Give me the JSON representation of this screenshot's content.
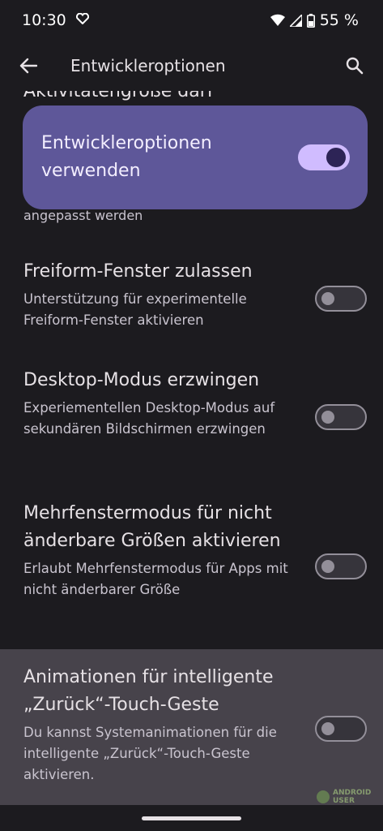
{
  "status_bar": {
    "time": "10:30",
    "battery": "55 %",
    "icons": [
      "heart-icon",
      "wifi-icon",
      "signal-icon",
      "battery-icon"
    ]
  },
  "app_bar": {
    "title": "Entwickleroptionen",
    "back_icon": "arrow-back-icon",
    "search_icon": "search-icon"
  },
  "master_switch": {
    "label": "Entwickleroptionen verwenden",
    "state": "on"
  },
  "partial_item": {
    "title_fragment": "Aktivitätengröße darf",
    "summary_fragment": "angepasst werden"
  },
  "settings": [
    {
      "title": "Freiform-Fenster zulassen",
      "summary": "Unterstützung für experimentelle Freiform-Fenster aktivieren",
      "state": "off"
    },
    {
      "title": "Desktop-Modus erzwingen",
      "summary": "Experiementellen Desktop-Modus auf sekundären Bildschirmen erzwingen",
      "state": "off"
    },
    {
      "title": "Mehrfenstermodus für nicht änderbare Größen aktivieren",
      "summary": "Erlaubt Mehrfenstermodus für Apps mit nicht änderbarer Größe",
      "state": "off"
    },
    {
      "title": "Animationen für intelligente „Zurück“-Touch-Geste",
      "summary": "Du kannst Systemanimationen für die intelligente „Zurück“-Touch-Geste aktivieren.",
      "state": "off"
    }
  ],
  "watermark": {
    "line1": "ANDROID",
    "line2": "USER"
  },
  "colors": {
    "background": "#1c1b1f",
    "master_switch_bg": "#5e5799",
    "highlight_row": "#47434b",
    "switch_on": "#d0bcff"
  }
}
